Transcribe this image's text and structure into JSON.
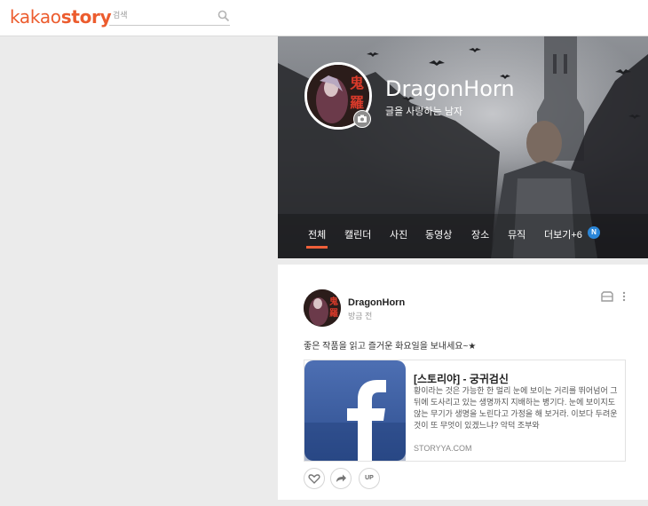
{
  "header": {
    "logo_prefix": "kakao",
    "logo_suffix": "story",
    "search_placeholder": "검색"
  },
  "profile": {
    "name": "DragonHorn",
    "description": "글을 사랑하는 남자",
    "tabs": [
      "전체",
      "캘린더",
      "사진",
      "동영상",
      "장소",
      "뮤직",
      "더보기+6"
    ],
    "badge": "N"
  },
  "post": {
    "author": "DragonHorn",
    "time": "방금 전",
    "text": "좋은 작품을 읽고 즐거운 화요일을 보내세요~★",
    "link": {
      "title": "[스토리야] - 궁귀검신",
      "description": "황이라는 것은 가능한 한 멀리 눈에 보이는 거리를 뛰어넘어 그 뒤에 도사리고 있는 생명까지 지배하는 병기다. 눈에 보이지도 않는 무기가 생명을 노린다고 가정을 해 보거라. 이보다 두려운 것이 또 무엇이 있겠느냐? 악덕 조부와",
      "domain": "STORYYA.COM"
    },
    "actions": {
      "up_label": "UP"
    }
  },
  "colors": {
    "accent": "#ec5c2e",
    "tab_underline": "#f0603a",
    "badge": "#2a86d8",
    "facebook_blue": "#3b5998"
  }
}
